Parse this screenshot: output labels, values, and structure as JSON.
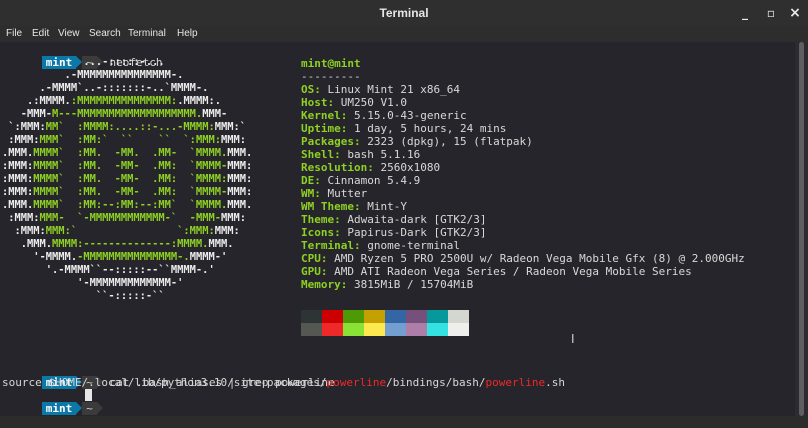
{
  "window": {
    "title": "Terminal",
    "minimize": "_",
    "maximize": "▫",
    "close": "×"
  },
  "menu": [
    "File",
    "Edit",
    "View",
    "Search",
    "Terminal",
    "Help"
  ],
  "prompt": {
    "user": "mint",
    "dir": "~"
  },
  "commands": {
    "first": "neofetch",
    "second": "cat .bash_aliases | grep powerline"
  },
  "output": {
    "source_prefix": "source $HOME/.local/lib/python3.10/site-packages/",
    "match1": "powerline",
    "mid": "/bindings/bash/",
    "match2": "powerline",
    "suffix": ".sh"
  },
  "logo": [
    [
      [
        "w",
        "             ...-:::::-..."
      ]
    ],
    [
      [
        "w",
        "          .-MMMMMMMMMMMMMMM-."
      ]
    ],
    [
      [
        "w",
        "      .-MMMM`..-:::::::-..`MMMM-."
      ]
    ],
    [
      [
        "w",
        "    .:MMMM."
      ],
      [
        "g",
        ":MMMMMMMMMMMMMMM:"
      ],
      [
        "w",
        ".MMMM:."
      ]
    ],
    [
      [
        "w",
        "   -MMM-"
      ],
      [
        "g",
        "M---MMMMMMMMMMMMMMMMMMM."
      ],
      [
        "w",
        "MMM-"
      ]
    ],
    [
      [
        "w",
        " `:MMM:"
      ],
      [
        "g",
        "MM`  :MMMM:....::-...-MMMM:"
      ],
      [
        "w",
        "MMM:`"
      ]
    ],
    [
      [
        "w",
        " :MMM:"
      ],
      [
        "g",
        "MMM`  :MM:`  ``    ``  `:MMM:"
      ],
      [
        "w",
        "MMM:"
      ]
    ],
    [
      [
        "w",
        ".MMM."
      ],
      [
        "g",
        "MMMM`  :MM.  -MM.  .MM-  `MMMM."
      ],
      [
        "w",
        "MMM."
      ]
    ],
    [
      [
        "w",
        ":MMM:"
      ],
      [
        "g",
        "MMMM`  :MM.  -MM-  .MM:  `MMMM-"
      ],
      [
        "w",
        "MMM:"
      ]
    ],
    [
      [
        "w",
        ":MMM:"
      ],
      [
        "g",
        "MMMM`  :MM.  -MM-  .MM:  `MMMM:"
      ],
      [
        "w",
        "MMM:"
      ]
    ],
    [
      [
        "w",
        ":MMM:"
      ],
      [
        "g",
        "MMMM`  :MM.  -MM-  .MM:  `MMMM-"
      ],
      [
        "w",
        "MMM:"
      ]
    ],
    [
      [
        "w",
        ".MMM."
      ],
      [
        "g",
        "MMMM`  :MM:--:MM:--:MM`  `MMMM."
      ],
      [
        "w",
        "MMM."
      ]
    ],
    [
      [
        "w",
        " :MMM:"
      ],
      [
        "g",
        "MMM-  `-MMMMMMMMMMMM-`  -MMM-"
      ],
      [
        "w",
        "MMM:"
      ]
    ],
    [
      [
        "w",
        "  :MMM:"
      ],
      [
        "g",
        "MMM:`                `:MMM:"
      ],
      [
        "w",
        "MMM:"
      ]
    ],
    [
      [
        "w",
        "   .MMM."
      ],
      [
        "g",
        "MMMM:--------------:MMMM."
      ],
      [
        "w",
        "MMM."
      ]
    ],
    [
      [
        "w",
        "     '-MMMM."
      ],
      [
        "g",
        "-MMMMMMMMMMMMMMM-."
      ],
      [
        "w",
        "MMMM-'"
      ]
    ],
    [
      [
        "w",
        "       '.-MMMM``--:::::--``MMMM-.'"
      ]
    ],
    [
      [
        "w",
        "            '-MMMMMMMMMMMMM-'"
      ]
    ],
    [
      [
        "w",
        "               ``-:::::-``"
      ]
    ]
  ],
  "info": {
    "header": "mint@mint",
    "sep": "---------",
    "rows": [
      {
        "k": "OS",
        "v": "Linux Mint 21 x86_64"
      },
      {
        "k": "Host",
        "v": "UM250 V1.0"
      },
      {
        "k": "Kernel",
        "v": "5.15.0-43-generic"
      },
      {
        "k": "Uptime",
        "v": "1 day, 5 hours, 24 mins"
      },
      {
        "k": "Packages",
        "v": "2323 (dpkg), 15 (flatpak)"
      },
      {
        "k": "Shell",
        "v": "bash 5.1.16"
      },
      {
        "k": "Resolution",
        "v": "2560x1080"
      },
      {
        "k": "DE",
        "v": "Cinnamon 5.4.9"
      },
      {
        "k": "WM",
        "v": "Mutter"
      },
      {
        "k": "WM Theme",
        "v": "Mint-Y"
      },
      {
        "k": "Theme",
        "v": "Adwaita-dark [GTK2/3]"
      },
      {
        "k": "Icons",
        "v": "Papirus-Dark [GTK2/3]"
      },
      {
        "k": "Terminal",
        "v": "gnome-terminal"
      },
      {
        "k": "CPU",
        "v": "AMD Ryzen 5 PRO 2500U w/ Radeon Vega Mobile Gfx (8) @ 2.000GHz"
      },
      {
        "k": "GPU",
        "v": "AMD ATI Radeon Vega Series / Radeon Vega Mobile Series"
      },
      {
        "k": "Memory",
        "v": "3815MiB / 15704MiB"
      }
    ]
  },
  "palette": {
    "top": [
      "#2e3436",
      "#cc0000",
      "#4e9a06",
      "#c4a000",
      "#3465a4",
      "#75507b",
      "#06989a",
      "#d3d7cf"
    ],
    "bottom": [
      "#555753",
      "#ef2929",
      "#8ae234",
      "#fce94f",
      "#729fcf",
      "#ad7fa8",
      "#34e2e2",
      "#eeeeec"
    ]
  }
}
